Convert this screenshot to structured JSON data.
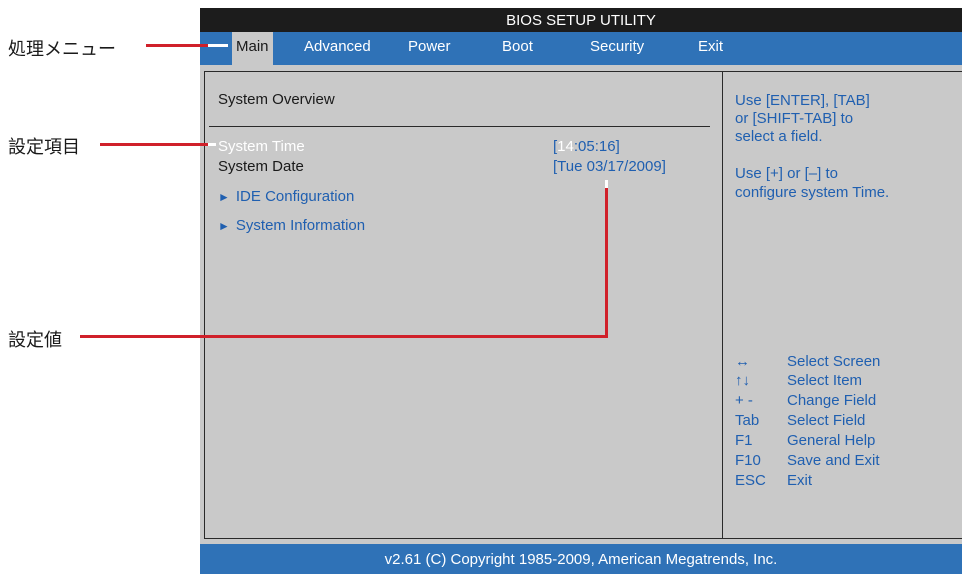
{
  "callouts": {
    "menu_label": "処理メニュー",
    "item_label": "設定項目",
    "value_label": "設定値"
  },
  "bios": {
    "title": "BIOS SETUP UTILITY",
    "menu": [
      "Main",
      "Advanced",
      "Power",
      "Boot",
      "Security",
      "Exit"
    ],
    "active_menu": "Main",
    "section_title": "System Overview",
    "items": [
      {
        "label": "System Time",
        "value_prefix": "[",
        "value_highlight": "14",
        "value_rest": ":05:16]"
      },
      {
        "label": "System Date",
        "value": "[Tue 03/17/2009]"
      }
    ],
    "submenus": [
      "IDE Configuration",
      "System Information"
    ],
    "submenu_marker": "►",
    "help": {
      "lines_top": [
        "Use [ENTER], [TAB]",
        "or [SHIFT-TAB] to",
        "select a field."
      ],
      "lines_mid": [
        "Use [+] or [–] to",
        "configure system Time."
      ],
      "keys": [
        {
          "key": "↔",
          "desc": "Select Screen"
        },
        {
          "key": "↑↓",
          "desc": "Select Item"
        },
        {
          "key": "+ -",
          "desc": "Change Field"
        },
        {
          "key": "Tab",
          "desc": "Select Field"
        },
        {
          "key": "F1",
          "desc": "General Help"
        },
        {
          "key": "F10",
          "desc": "Save and Exit"
        },
        {
          "key": "ESC",
          "desc": "Exit"
        }
      ]
    },
    "footer": "v2.61 (C) Copyright 1985-2009, American Megatrends, Inc."
  },
  "colors": {
    "menu_bar": "#2f72b7",
    "title_bar": "#1c1c1c",
    "panel_bg": "#c9c9c9",
    "value_text": "#1f5fb0",
    "callout_line": "#d0202a"
  }
}
